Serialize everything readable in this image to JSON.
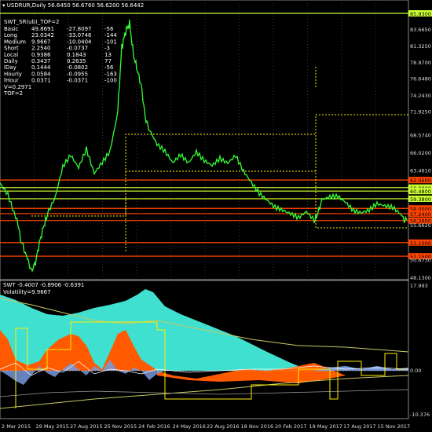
{
  "header": {
    "symbol": "USDRUR,Daily",
    "ohlc": "56.6450 56.6760 56.6200 56.6442"
  },
  "indicator_name": "SWT_SR(ub)_TOF=2",
  "stats_rows": [
    {
      "label": "Basic",
      "v1": "49.8691",
      "v2": "-27.8097",
      "v3": "-56"
    },
    {
      "label": "Long",
      "v1": "23.0342",
      "v2": "-33.0746",
      "v3": "-144"
    },
    {
      "label": "Medium",
      "v1": "9.9667",
      "v2": "-10.0404",
      "v3": "-101"
    },
    {
      "label": "Short",
      "v1": "2.2540",
      "v2": "-0.0737",
      "v3": "-3"
    },
    {
      "label": "Local",
      "v1": "0.9386",
      "v2": "0.1843",
      "v3": "13"
    },
    {
      "label": "Daily",
      "v1": "0.3437",
      "v2": "0.2635",
      "v3": "77"
    },
    {
      "label": "lDay",
      "v1": "0.1444",
      "v2": "-0.0802",
      "v3": "-56"
    },
    {
      "label": "Hourly",
      "v1": "0.0584",
      "v2": "-0.0955",
      "v3": "-163"
    },
    {
      "label": "lHour",
      "v1": "0.0371",
      "v2": "-0.0371",
      "v3": "-100"
    }
  ],
  "stats_footer": [
    "V=0.2971",
    "TOF=2"
  ],
  "price_levels": [
    {
      "value": "85.9300",
      "color": "#ccff33",
      "kind": "line"
    },
    {
      "value": "83.6650",
      "kind": "axis"
    },
    {
      "value": "81.3250",
      "kind": "axis"
    },
    {
      "value": "78.9700",
      "kind": "axis"
    },
    {
      "value": "76.6480",
      "kind": "axis"
    },
    {
      "value": "74.2430",
      "kind": "axis"
    },
    {
      "value": "71.9250",
      "kind": "axis"
    },
    {
      "value": "68.5740",
      "kind": "axis"
    },
    {
      "value": "66.0200",
      "kind": "axis"
    },
    {
      "value": "63.4610",
      "kind": "axis"
    },
    {
      "value": "62.0600",
      "color": "#ff4400",
      "kind": "line"
    },
    {
      "value": "60.9800",
      "color": "#ccff33",
      "kind": "line"
    },
    {
      "value": "60.4800",
      "color": "#ccff33",
      "kind": "line"
    },
    {
      "value": "59.3800",
      "color": "#ccff33",
      "kind": "line"
    },
    {
      "value": "58.0000",
      "color": "#ff4400",
      "kind": "line"
    },
    {
      "value": "57.2400",
      "color": "#ff4400",
      "kind": "line"
    },
    {
      "value": "56.2600",
      "color": "#ff4400",
      "kind": "line"
    },
    {
      "value": "55.6620",
      "kind": "axis"
    },
    {
      "value": "53.1000",
      "color": "#ff4400",
      "kind": "line"
    },
    {
      "value": "51.1500",
      "color": "#ff4400",
      "kind": "line"
    },
    {
      "value": "50.6730",
      "kind": "axis"
    },
    {
      "value": "48.1300",
      "kind": "axis"
    }
  ],
  "sub_header": "SWT -0.4007 -0.8906 -0.6391",
  "sub_volatility": "Volatility=9.9667",
  "sub_axis": {
    "top": "17.993",
    "zero": "0.00",
    "bottom": "-10.376"
  },
  "x_axis": [
    "2 Mar 2015",
    "29 May 2015",
    "27 Aug 2015",
    "25 Nov 2015",
    "24 Feb 2016",
    "24 May 2016",
    "22 Aug 2016",
    "18 Nov 2016",
    "20 Feb 2017",
    "19 May 2017",
    "17 Aug 2017",
    "15 Nov 2017"
  ],
  "colors": {
    "price": "#33ff33",
    "support": "#ff4400",
    "resistance": "#ccff33",
    "cyan": "#40e0d0",
    "orange": "#ff5a00",
    "blue": "#7799dd",
    "yellow": "#ffee00"
  }
}
